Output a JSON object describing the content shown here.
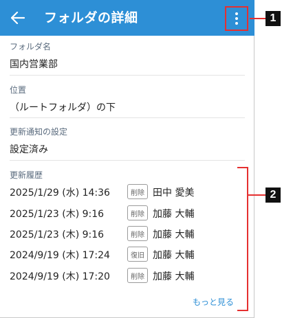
{
  "appbar": {
    "title": "フォルダの詳細",
    "back_icon": "arrow-left-icon",
    "more_icon": "more-vertical-icon",
    "background": "#2d8fd6"
  },
  "folder_name": {
    "label": "フォルダ名",
    "value": "国内営業部"
  },
  "location": {
    "label": "位置",
    "value": "（ルートフォルダ）の下"
  },
  "notification": {
    "label": "更新通知の設定",
    "value": "設定済み"
  },
  "history": {
    "label": "更新履歴",
    "items": [
      {
        "date": "2025/1/29 (水) 14:36",
        "action": "削除",
        "user": "田中 愛美"
      },
      {
        "date": "2025/1/23 (木) 9:16",
        "action": "削除",
        "user": "加藤 大輔"
      },
      {
        "date": "2025/1/23 (木) 9:16",
        "action": "削除",
        "user": "加藤 大輔"
      },
      {
        "date": "2024/9/19 (木) 17:24",
        "action": "復旧",
        "user": "加藤 大輔"
      },
      {
        "date": "2024/9/19 (木) 17:20",
        "action": "削除",
        "user": "加藤 大輔"
      }
    ],
    "more_label": "もっと見る"
  },
  "callouts": {
    "one": "1",
    "two": "2",
    "accent": "#e52f2f"
  }
}
